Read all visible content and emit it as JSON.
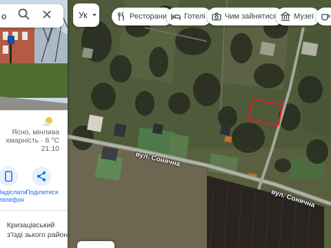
{
  "search": {
    "query": "о"
  },
  "language": {
    "label": "Ук"
  },
  "chips": [
    {
      "label": "Ресторани",
      "icon": "fork-knife-icon"
    },
    {
      "label": "Готелі",
      "icon": "bed-icon"
    },
    {
      "label": "Чим зайнятися",
      "icon": "camera-icon"
    },
    {
      "label": "Музеї",
      "icon": "museum-icon"
    }
  ],
  "weather": {
    "line1": "Ясно, мінлива",
    "line2": "хмарність · 8 °C",
    "time": "21:10",
    "icon": "sun-cloud-icon"
  },
  "actions": [
    {
      "line1": "Надіслати",
      "line2": "телефон",
      "icon": "phone-send-icon"
    },
    {
      "line1": "Поділитися",
      "line2": "",
      "icon": "share-icon"
    }
  ],
  "address": {
    "line1": "Кризацівський",
    "line2": "з'їзді зького району"
  },
  "map": {
    "streets": [
      {
        "name": "вул. Сонячна"
      },
      {
        "name": "вул. Сонячна"
      }
    ],
    "highlight_color": "#e02020"
  }
}
